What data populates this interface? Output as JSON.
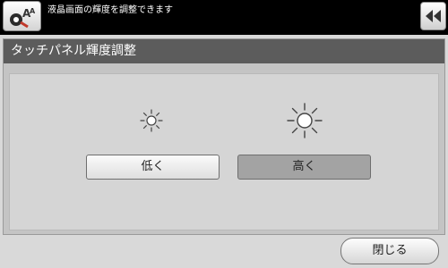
{
  "header": {
    "icon": "accessibility-brightness-icon",
    "message": "液晶画面の輝度を調整できます",
    "back_icon": "double-left-arrow-icon"
  },
  "panel": {
    "title": "タッチパネル輝度調整",
    "low_icon": "small-sun-icon",
    "high_icon": "large-sun-icon",
    "low_label": "低く",
    "high_label": "高く",
    "selected": "high"
  },
  "footer": {
    "close_label": "閉じる"
  },
  "colors": {
    "topbar": "#000000",
    "panel_header": "#5c5c5c",
    "selected_button": "#a3a3a3"
  }
}
